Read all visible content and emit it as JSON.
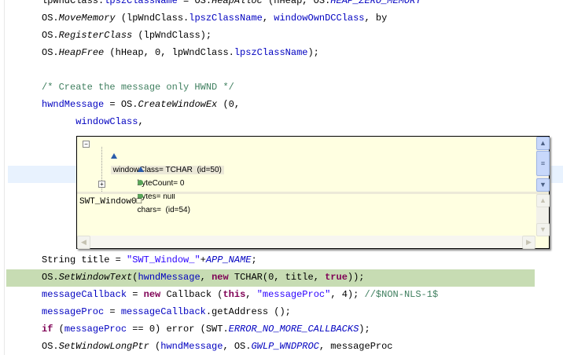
{
  "code_lines": [
    [
      [
        "lpWndClass.",
        ""
      ],
      [
        "lpszClassName",
        "fld"
      ],
      [
        " = OS.",
        ""
      ],
      [
        "HeapAlloc",
        "meth"
      ],
      [
        " (hHeap, OS.",
        ""
      ],
      [
        "HEAP_ZERO_MEMORY",
        "sfld"
      ]
    ],
    [
      [
        "OS.",
        ""
      ],
      [
        "MoveMemory",
        "meth"
      ],
      [
        " (lpWndClass.",
        ""
      ],
      [
        "lpszClassName",
        "fld"
      ],
      [
        ", ",
        ""
      ],
      [
        "windowOwnDCClass",
        "fld"
      ],
      [
        ", by",
        ""
      ]
    ],
    [
      [
        "OS.",
        ""
      ],
      [
        "RegisterClass",
        "meth"
      ],
      [
        " (lpWndClass);",
        ""
      ]
    ],
    [
      [
        "OS.",
        ""
      ],
      [
        "HeapFree",
        "meth"
      ],
      [
        " (hHeap, 0, lpWndClass.",
        ""
      ],
      [
        "lpszClassName",
        "fld"
      ],
      [
        ");",
        ""
      ]
    ],
    [],
    [
      [
        "/* Create the message only HWND */",
        "cmt"
      ]
    ],
    [
      [
        "hwndMessage",
        "fld"
      ],
      [
        " = OS.",
        ""
      ],
      [
        "CreateWindowEx",
        "meth"
      ],
      [
        " (0,",
        ""
      ]
    ],
    [
      [
        "      ",
        ""
      ],
      [
        "windowClass",
        "fld"
      ],
      [
        ",",
        ""
      ]
    ],
    [],
    [],
    [],
    [],
    [],
    [],
    [],
    [
      [
        "String title = ",
        ""
      ],
      [
        "\"SWT_Window_\"",
        "str"
      ],
      [
        "+",
        ""
      ],
      [
        "APP_NAME",
        "sfld"
      ],
      [
        ";",
        ""
      ]
    ],
    [
      [
        "OS.",
        ""
      ],
      [
        "SetWindowText",
        "meth"
      ],
      [
        "(",
        ""
      ],
      [
        "hwndMessage",
        "fld"
      ],
      [
        ", ",
        ""
      ],
      [
        "new",
        "kw"
      ],
      [
        " TCHAR(0, title, ",
        ""
      ],
      [
        "true",
        "kw"
      ],
      [
        "));",
        ""
      ]
    ],
    [
      [
        "messageCallback",
        "fld"
      ],
      [
        " = ",
        ""
      ],
      [
        "new",
        "kw"
      ],
      [
        " Callback (",
        ""
      ],
      [
        "this",
        "kw"
      ],
      [
        ", ",
        ""
      ],
      [
        "\"messageProc\"",
        "str"
      ],
      [
        ", 4); ",
        ""
      ],
      [
        "//$NON-NLS-1$",
        "cmt"
      ]
    ],
    [
      [
        "messageProc",
        "fld"
      ],
      [
        " = ",
        ""
      ],
      [
        "messageCallback",
        "fld"
      ],
      [
        ".getAddress ();",
        ""
      ]
    ],
    [
      [
        "if",
        "kw"
      ],
      [
        " (",
        ""
      ],
      [
        "messageProc",
        "fld"
      ],
      [
        " == 0) error (SWT.",
        ""
      ],
      [
        "ERROR_NO_MORE_CALLBACKS",
        "sfld"
      ],
      [
        ");",
        ""
      ]
    ],
    [
      [
        "OS.",
        ""
      ],
      [
        "SetWindowLongPtr",
        "meth"
      ],
      [
        " (",
        ""
      ],
      [
        "hwndMessage",
        "fld"
      ],
      [
        ", OS.",
        ""
      ],
      [
        "GWLP_WNDPROC",
        "sfld"
      ],
      [
        ", messageProc",
        ""
      ]
    ]
  ],
  "hover": {
    "root": "windowClass= TCHAR  (id=50)",
    "children": [
      {
        "label": "byteCount= 0",
        "icon": "triangle"
      },
      {
        "label": "bytes= null",
        "icon": "dot"
      },
      {
        "label": "chars=  (id=54)",
        "icon": "dot",
        "expandable": true
      }
    ],
    "detail": "SWT_Window0□"
  },
  "colors": {
    "keyword": "#7f0055",
    "field": "#0000c0",
    "string": "#2a00ff",
    "comment": "#3f7f5f",
    "current_line": "#c7dcb3"
  }
}
